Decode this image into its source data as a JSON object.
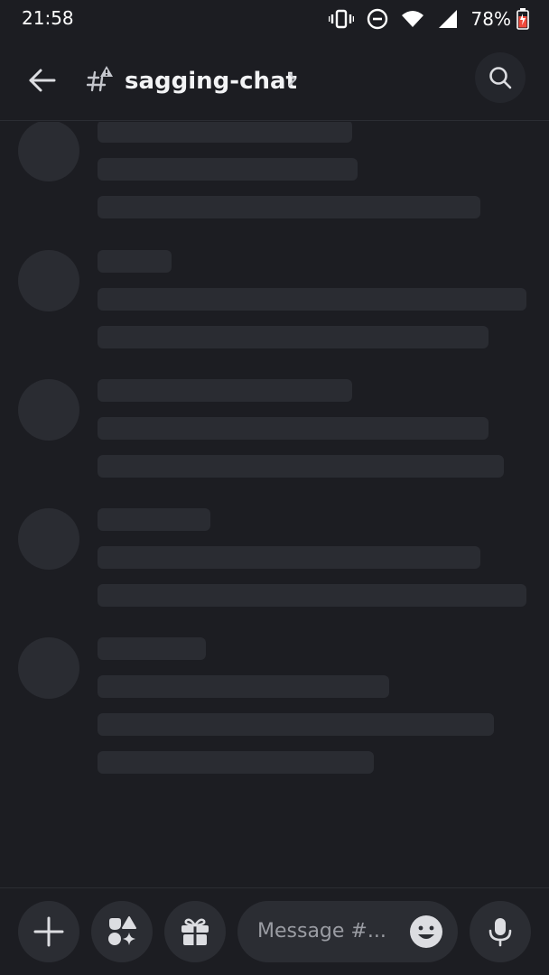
{
  "status_bar": {
    "time": "21:58",
    "battery_percent": "78%",
    "icons": [
      "vibrate-icon",
      "do-not-disturb-icon",
      "wifi-icon",
      "signal-icon",
      "battery-charging-icon"
    ]
  },
  "header": {
    "channel_name": "sagging-chat",
    "icons": [
      "back-arrow-icon",
      "channel-hash-alert-icon",
      "chevron-right-icon",
      "search-icon"
    ]
  },
  "composer": {
    "placeholder": "Message #...",
    "icons": [
      "plus-icon",
      "apps-icon",
      "gift-icon",
      "emoji-icon",
      "microphone-icon"
    ]
  },
  "colors": {
    "background": "#1c1d22",
    "skeleton": "#2a2c32",
    "button_bg": "#2b2d33",
    "text": "#f2f3f5",
    "muted_text": "#9a9ca3"
  }
}
